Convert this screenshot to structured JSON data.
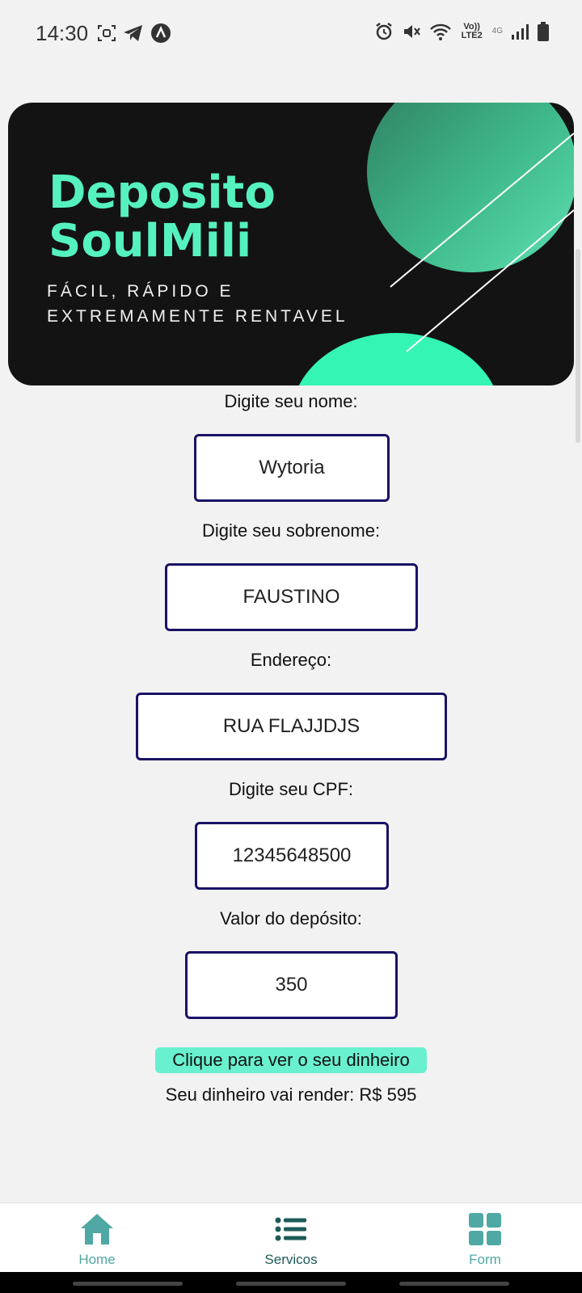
{
  "status_bar": {
    "time": "14:30",
    "left_icons": [
      "screen-record-icon",
      "telegram-icon",
      "app-a-icon"
    ],
    "right_icons": [
      "alarm-icon",
      "mute-icon",
      "wifi-icon",
      "volte-icon",
      "4g-icon",
      "signal-icon",
      "battery-icon"
    ],
    "volte_label": "Vo)) LTE2",
    "network_label": "4G"
  },
  "banner": {
    "title": "Deposito\nSoulMili",
    "subtitle": "FÁCIL, RÁPIDO E\nEXTREMAMENTE RENTAVEL",
    "colors": {
      "background": "#131313",
      "accent": "#55f2c0",
      "circle": "#34f5b4"
    }
  },
  "form": {
    "fields": [
      {
        "label": "Digite seu nome:",
        "value": "Wytoria"
      },
      {
        "label": "Digite seu sobrenome:",
        "value": "FAUSTINO"
      },
      {
        "label": "Endereço:",
        "value": "RUA FLAJJDJS"
      },
      {
        "label": "Digite seu CPF:",
        "value": "12345648500"
      },
      {
        "label": "Valor do depósito:",
        "value": "350"
      }
    ],
    "button_label": "Clique para ver o seu dinheiro",
    "result_text": "Seu dinheiro vai render: R$ 595"
  },
  "bottom_nav": {
    "items": [
      {
        "label": "Home",
        "icon": "home-icon",
        "color": "#4fa8a3"
      },
      {
        "label": "Servicos",
        "icon": "list-icon",
        "color": "#1d5a57"
      },
      {
        "label": "Form",
        "icon": "grid-icon",
        "color": "#4fa8a3"
      }
    ]
  }
}
